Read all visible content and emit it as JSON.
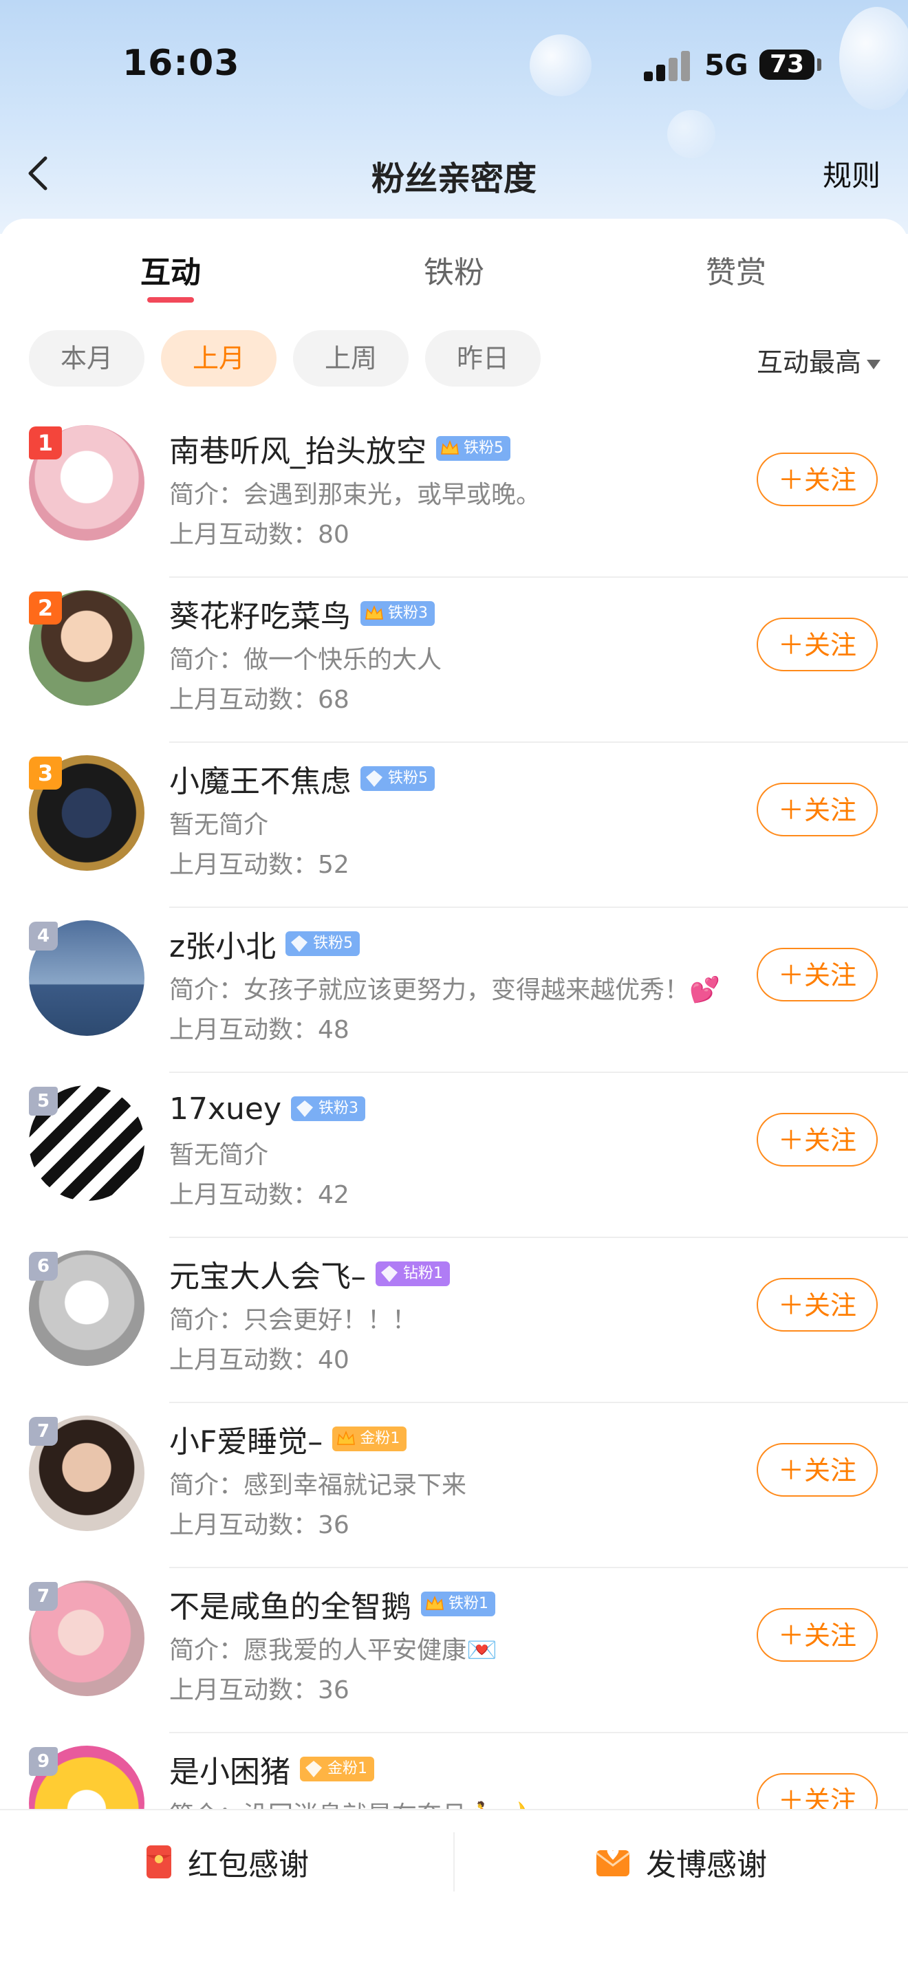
{
  "status": {
    "time": "16:03",
    "network": "5G",
    "battery": "73"
  },
  "nav": {
    "title": "粉丝亲密度",
    "rules": "规则"
  },
  "tabs": [
    {
      "label": "互动",
      "active": true
    },
    {
      "label": "铁粉",
      "active": false
    },
    {
      "label": "赞赏",
      "active": false
    }
  ],
  "filters": [
    {
      "label": "本月",
      "active": false
    },
    {
      "label": "上月",
      "active": true
    },
    {
      "label": "上周",
      "active": false
    },
    {
      "label": "昨日",
      "active": false
    }
  ],
  "sort": {
    "label": "互动最高"
  },
  "follow_label": "＋关注",
  "fans": [
    {
      "rank": "1",
      "name": "南巷听风_抬头放空",
      "badge": "铁粉5",
      "badge_type": "crown",
      "desc": "简介：会遇到那束光，或早或晚。",
      "count": "上月互动数：80"
    },
    {
      "rank": "2",
      "name": "葵花籽吃菜鸟",
      "badge": "铁粉3",
      "badge_type": "crown",
      "desc": "简介：做一个快乐的大人",
      "count": "上月互动数：68"
    },
    {
      "rank": "3",
      "name": "小魔王不焦虑",
      "badge": "铁粉5",
      "badge_type": "diamond",
      "desc": "暂无简介",
      "count": "上月互动数：52"
    },
    {
      "rank": "4",
      "name": "z张小北",
      "badge": "铁粉5",
      "badge_type": "diamond",
      "desc": "简介：女孩子就应该更努力，变得越来越优秀！💕",
      "count": "上月互动数：48"
    },
    {
      "rank": "5",
      "name": "17xuey",
      "badge": "铁粉3",
      "badge_type": "diamond",
      "desc": "暂无简介",
      "count": "上月互动数：42"
    },
    {
      "rank": "6",
      "name": "元宝大人会飞–",
      "badge": "钻粉1",
      "badge_type": "purple",
      "desc": "简介：只会更好！！！",
      "count": "上月互动数：40"
    },
    {
      "rank": "7",
      "name": "小F爱睡觉–",
      "badge": "金粉1",
      "badge_type": "gold-crown",
      "desc": "简介：感到幸福就记录下来",
      "count": "上月互动数：36"
    },
    {
      "rank": "7",
      "name": "不是咸鱼的全智鹅",
      "badge": "铁粉1",
      "badge_type": "crown",
      "desc": "简介：愿我爱的人平安健康💌",
      "count": "上月互动数：36"
    },
    {
      "rank": "9",
      "name": "是小困猪",
      "badge": "金粉1",
      "badge_type": "gold",
      "desc": "简介：没回消息就是在奔月🏃🌙",
      "count": ""
    }
  ],
  "bottom": {
    "red_packet": "红包感谢",
    "post": "发博感谢"
  },
  "colors": {
    "accent": "#ff7e00",
    "tab_underline": "#f2495a",
    "iron_badge": "#7aaef5",
    "diamond_badge": "#b07cf5",
    "gold_badge": "#ffb443"
  }
}
